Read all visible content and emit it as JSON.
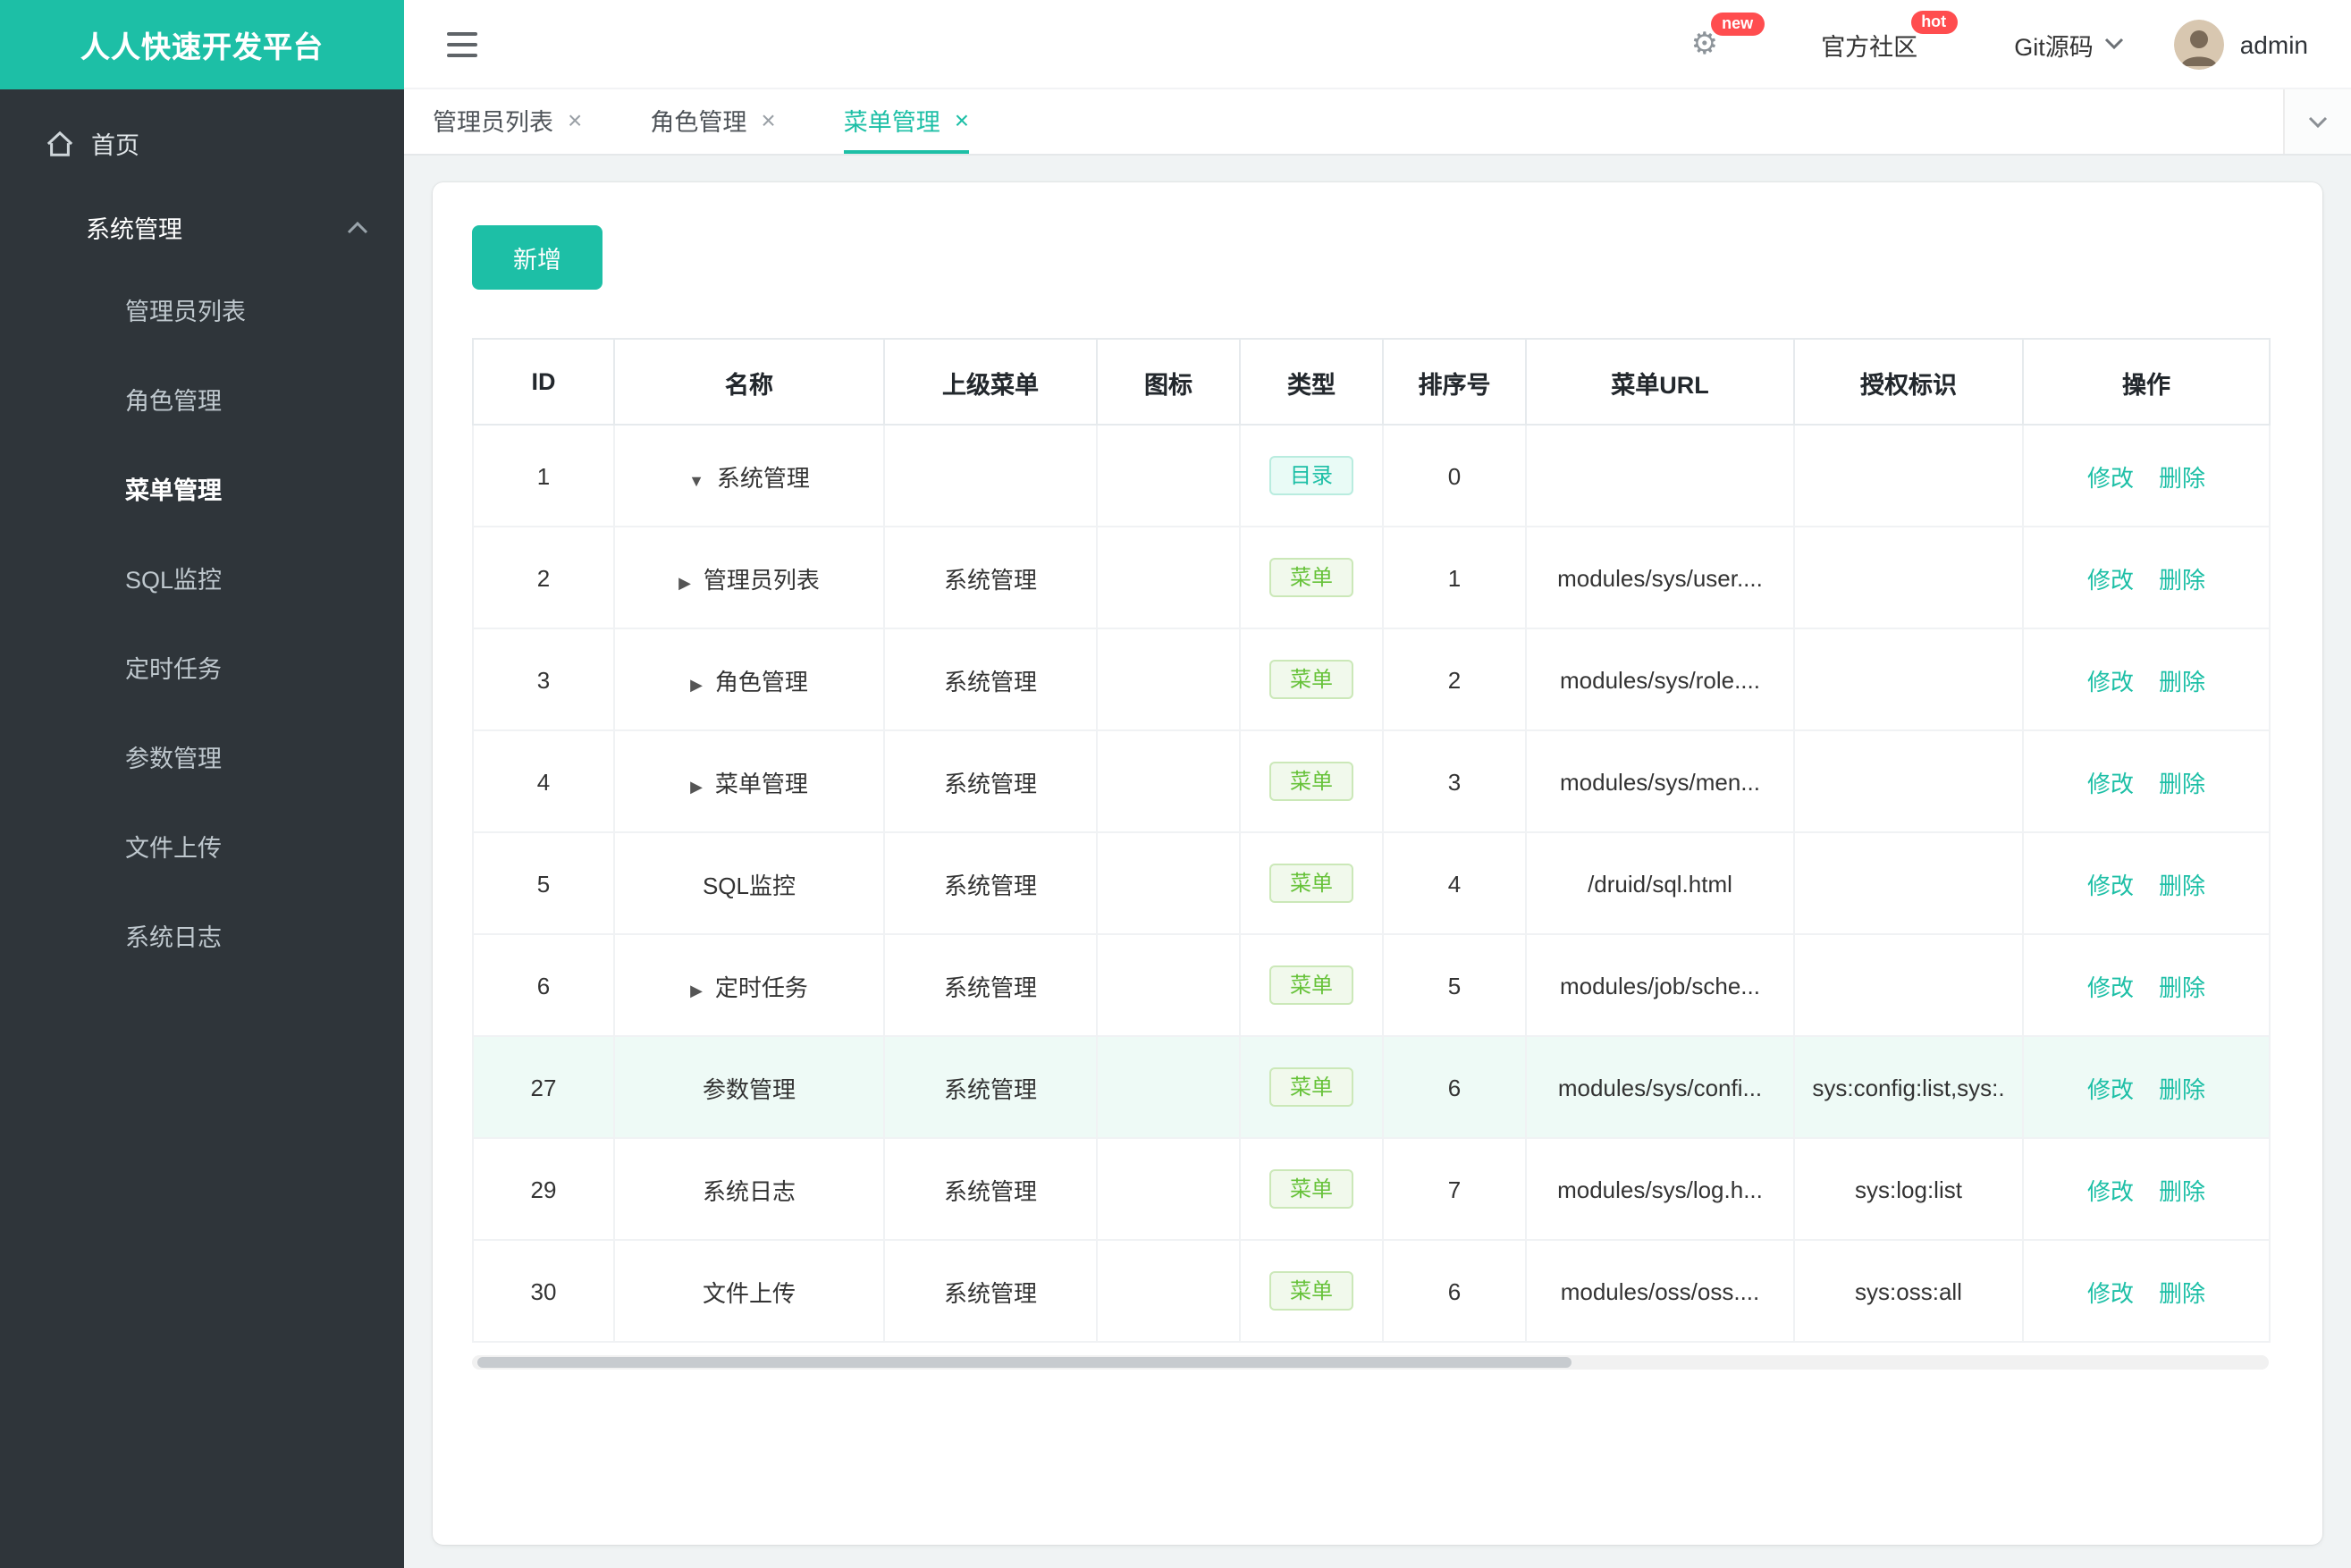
{
  "brand": {
    "title": "人人快速开发平台"
  },
  "topbar": {
    "new_badge": "new",
    "community": "官方社区",
    "hot_badge": "hot",
    "git": "Git源码",
    "username": "admin"
  },
  "tabs": {
    "items": [
      {
        "label": "管理员列表",
        "slug": "admin-list",
        "active": false
      },
      {
        "label": "角色管理",
        "slug": "role-management",
        "active": false
      },
      {
        "label": "菜单管理",
        "slug": "menu-management",
        "active": true
      }
    ]
  },
  "sidebar": {
    "home": "首页",
    "group": "系统管理",
    "active_item": "菜单管理",
    "items": [
      {
        "label": "管理员列表",
        "slug": "admin-list"
      },
      {
        "label": "角色管理",
        "slug": "role-management"
      },
      {
        "label": "菜单管理",
        "slug": "menu-management"
      },
      {
        "label": "SQL监控",
        "slug": "sql-monitor"
      },
      {
        "label": "定时任务",
        "slug": "scheduled-tasks"
      },
      {
        "label": "参数管理",
        "slug": "parameter-management"
      },
      {
        "label": "文件上传",
        "slug": "file-upload"
      },
      {
        "label": "系统日志",
        "slug": "system-log"
      }
    ]
  },
  "toolbar": {
    "add": "新增"
  },
  "table": {
    "headers": [
      "ID",
      "名称",
      "上级菜单",
      "图标",
      "类型",
      "排序号",
      "菜单URL",
      "授权标识",
      "操作"
    ],
    "type_labels": {
      "dir": "目录",
      "menu": "菜单"
    },
    "actions": {
      "edit": "修改",
      "delete": "删除"
    },
    "rows": [
      {
        "id": "1",
        "caret": "down",
        "name": "系统管理",
        "parent": "",
        "type": "dir",
        "sort": "0",
        "url": "",
        "auth": "",
        "highlight": false
      },
      {
        "id": "2",
        "caret": "right",
        "name": "管理员列表",
        "parent": "系统管理",
        "type": "menu",
        "sort": "1",
        "url": "modules/sys/user....",
        "auth": "",
        "highlight": false
      },
      {
        "id": "3",
        "caret": "right",
        "name": "角色管理",
        "parent": "系统管理",
        "type": "menu",
        "sort": "2",
        "url": "modules/sys/role....",
        "auth": "",
        "highlight": false
      },
      {
        "id": "4",
        "caret": "right",
        "name": "菜单管理",
        "parent": "系统管理",
        "type": "menu",
        "sort": "3",
        "url": "modules/sys/men...",
        "auth": "",
        "highlight": false
      },
      {
        "id": "5",
        "caret": "",
        "name": "SQL监控",
        "parent": "系统管理",
        "type": "menu",
        "sort": "4",
        "url": "/druid/sql.html",
        "auth": "",
        "highlight": false
      },
      {
        "id": "6",
        "caret": "right",
        "name": "定时任务",
        "parent": "系统管理",
        "type": "menu",
        "sort": "5",
        "url": "modules/job/sche...",
        "auth": "",
        "highlight": false
      },
      {
        "id": "27",
        "caret": "",
        "name": "参数管理",
        "parent": "系统管理",
        "type": "menu",
        "sort": "6",
        "url": "modules/sys/confi...",
        "auth": "sys:config:list,sys:.",
        "highlight": true
      },
      {
        "id": "29",
        "caret": "",
        "name": "系统日志",
        "parent": "系统管理",
        "type": "menu",
        "sort": "7",
        "url": "modules/sys/log.h...",
        "auth": "sys:log:list",
        "highlight": false
      },
      {
        "id": "30",
        "caret": "",
        "name": "文件上传",
        "parent": "系统管理",
        "type": "menu",
        "sort": "6",
        "url": "modules/oss/oss....",
        "auth": "sys:oss:all",
        "highlight": false
      }
    ]
  },
  "icons": {
    "hamburger": "☰",
    "gear": "⚙",
    "close": "×",
    "caret_down": "▼",
    "caret_right": "▶",
    "chevron_down": "⌄",
    "chevron_up": "⌃",
    "home": "⌂"
  },
  "colors": {
    "accent": "#1dbfa6",
    "sidebar_bg": "#2f353a",
    "badge_red": "#ff4d4f",
    "row_highlight": "#eefaf6",
    "tag_menu_green": "#67c23a"
  }
}
